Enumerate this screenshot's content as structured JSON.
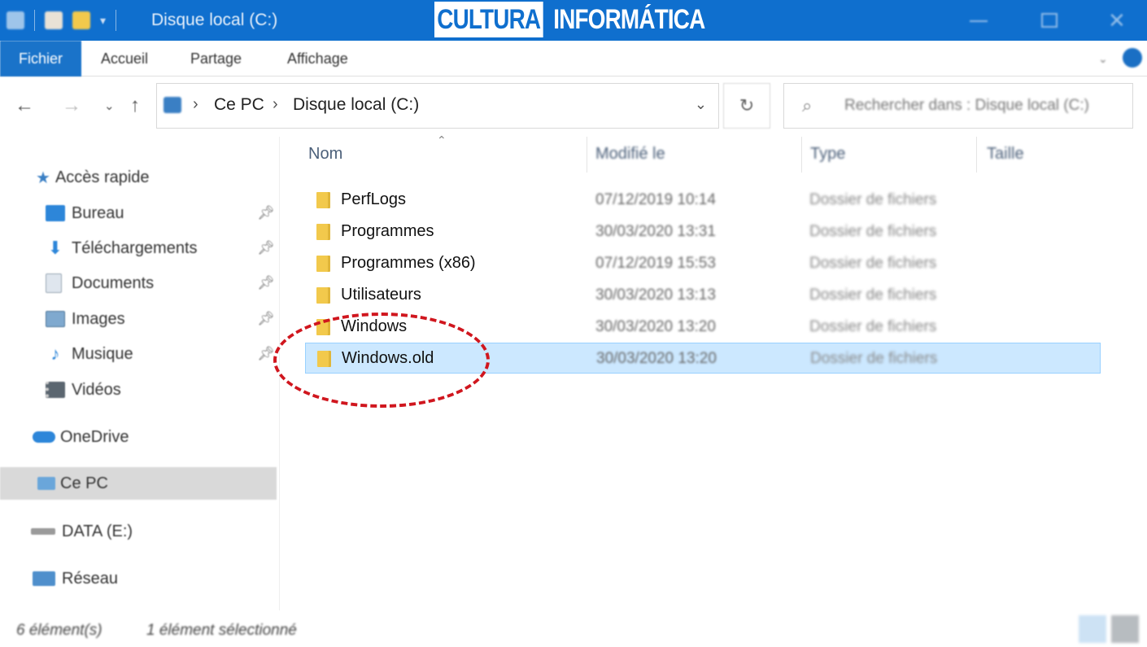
{
  "titlebar": {
    "title": "Disque local (C:)",
    "brand_part1": "CULTURA",
    "brand_part2": "INFORMÁTICA",
    "accent": "#0f6fce"
  },
  "ribbon": {
    "tabs": [
      "Fichier",
      "Accueil",
      "Partage",
      "Affichage"
    ]
  },
  "address": {
    "crumbs": [
      "Ce PC",
      "Disque local (C:)"
    ],
    "search_placeholder": "Rechercher dans : Disque local (C:)"
  },
  "sidebar": {
    "quick_access": "Accès rapide",
    "items": [
      {
        "label": "Bureau",
        "icon": "desktop-icon",
        "pinned": true
      },
      {
        "label": "Téléchargements",
        "icon": "download-icon",
        "pinned": true
      },
      {
        "label": "Documents",
        "icon": "documents-icon",
        "pinned": true
      },
      {
        "label": "Images",
        "icon": "images-icon",
        "pinned": true
      },
      {
        "label": "Musique",
        "icon": "music-icon",
        "pinned": true
      },
      {
        "label": "Vidéos",
        "icon": "videos-icon",
        "pinned": false
      }
    ],
    "onedrive": "OneDrive",
    "this_pc": "Ce PC",
    "data_drive": "DATA (E:)",
    "network": "Réseau"
  },
  "list": {
    "columns": [
      "Nom",
      "Modifié le",
      "Type",
      "Taille"
    ],
    "rows": [
      {
        "name": "PerfLogs",
        "date": "07/12/2019 10:14",
        "type": "Dossier de fichiers"
      },
      {
        "name": "Programmes",
        "date": "30/03/2020 13:31",
        "type": "Dossier de fichiers"
      },
      {
        "name": "Programmes (x86)",
        "date": "07/12/2019 15:53",
        "type": "Dossier de fichiers"
      },
      {
        "name": "Utilisateurs",
        "date": "30/03/2020 13:13",
        "type": "Dossier de fichiers"
      },
      {
        "name": "Windows",
        "date": "30/03/2020 13:20",
        "type": "Dossier de fichiers"
      },
      {
        "name": "Windows.old",
        "date": "30/03/2020 13:20",
        "type": "Dossier de fichiers",
        "selected": true
      }
    ]
  },
  "status": {
    "count": "6 élément(s)",
    "selection": "1 élément sélectionné"
  }
}
